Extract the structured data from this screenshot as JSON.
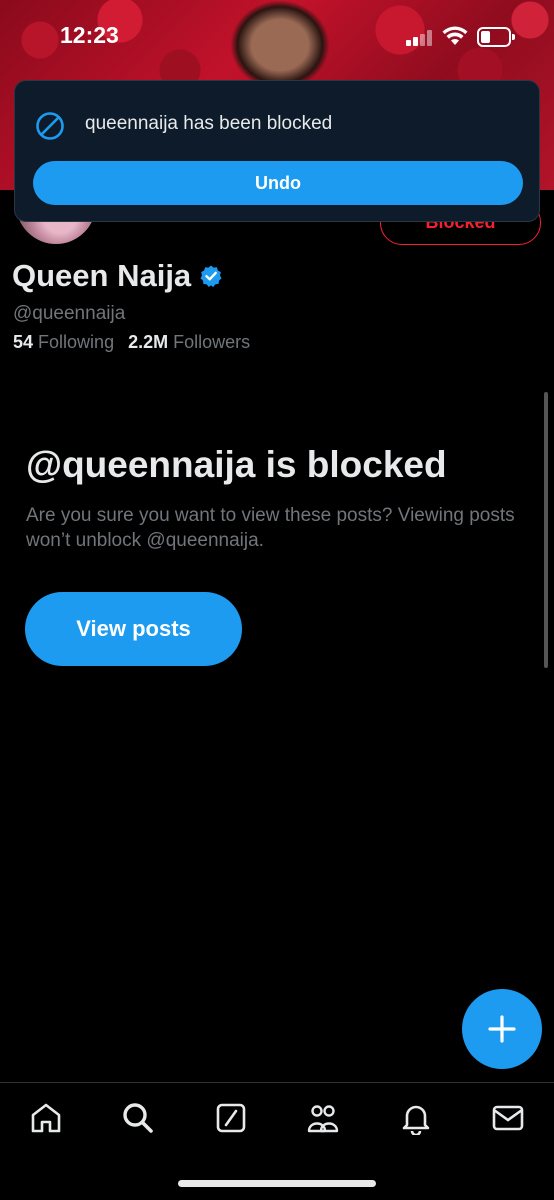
{
  "status_bar": {
    "time": "12:23"
  },
  "toast": {
    "message": "queennaija has been blocked",
    "undo_label": "Undo"
  },
  "profile": {
    "name": "Queen Naija",
    "handle": "@queennaija",
    "following_count": "54",
    "following_label": "Following",
    "followers_count": "2.2M",
    "followers_label": "Followers",
    "blocked_button_label": "Blocked"
  },
  "blocked_notice": {
    "title": "@queennaija is blocked",
    "description": "Are you sure you want to view these posts? Viewing posts won’t unblock @queennaija.",
    "view_posts_label": "View posts"
  },
  "nav": {
    "items": [
      "home-icon",
      "search-icon",
      "grok-icon",
      "communities-icon",
      "notifications-icon",
      "messages-icon"
    ]
  },
  "colors": {
    "accent": "#1d9bf0",
    "danger": "#f4212e",
    "muted": "#71767b",
    "text": "#e7e9ea"
  }
}
